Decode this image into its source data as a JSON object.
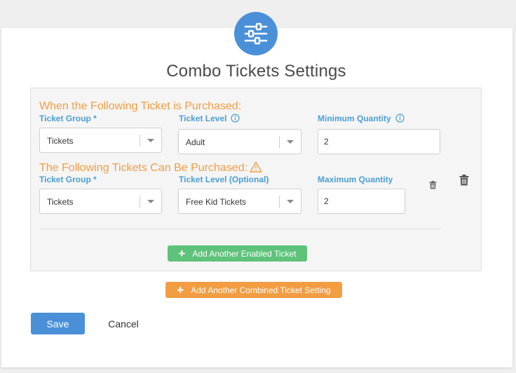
{
  "title": "Combo Tickets Settings",
  "header_icon": "sliders-icon",
  "sections": {
    "purchased_heading": "When the Following Ticket is Purchased:",
    "enabled_heading": "The Following Tickets Can Be Purchased:"
  },
  "row1": {
    "ticket_group_label": "Ticket Group *",
    "ticket_group_value": "Tickets",
    "ticket_level_label": "Ticket Level",
    "ticket_level_value": "Adult",
    "min_qty_label": "Minimum Quantity",
    "min_qty_value": "2"
  },
  "row2": {
    "ticket_group_label": "Ticket Group *",
    "ticket_group_value": "Tickets",
    "ticket_level_label": "Ticket Level (Optional)",
    "ticket_level_value": "Free Kid Tickets",
    "max_qty_label": "Maximum Quantity",
    "max_qty_value": "2"
  },
  "buttons": {
    "add_enabled": "Add Another Enabled Ticket",
    "add_combined": "Add Another Combined Ticket Setting",
    "save": "Save",
    "cancel": "Cancel"
  },
  "colors": {
    "accent_blue": "#4a90d9",
    "label_blue": "#4a9fd5",
    "orange": "#f29d42",
    "green": "#5ec27a"
  }
}
